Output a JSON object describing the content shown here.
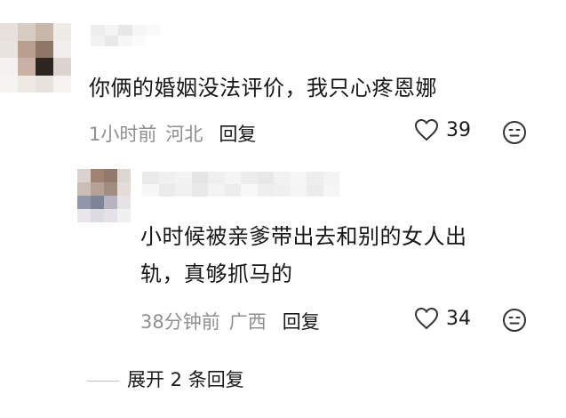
{
  "comments": [
    {
      "text": "你俩的婚姻没法评价，我只心疼恩娜",
      "time": "1小时前",
      "location": "河北",
      "reply_label": "回复",
      "likes": "39",
      "avatar_colors": [
        "#e6e1dc",
        "#d6ccc4",
        "#c8b8ac",
        "#efece8",
        "#e9e4df",
        "#b99f90",
        "#8f7666",
        "#f1eeeb",
        "#f4f1ee",
        "#c9b2a4",
        "#2d2520",
        "#dcd4ce",
        "#f6f4f2",
        "#efe9e4",
        "#e8e2dc",
        "#f5f3f1"
      ],
      "name_colors": [
        "#eeeeee",
        "#f4f4f4",
        "#e7e7e7",
        "#f6f6f6",
        "#fafafa",
        "#f2f2f2",
        "#e9e9e9",
        "#f7f7f7",
        "#fbfbfb",
        "#ffffff"
      ]
    },
    {
      "text_line1": "小时候被亲爹带出去和别的女人出",
      "text_line2": "轨，真够抓马的",
      "time": "38分钟前",
      "location": "广西",
      "reply_label": "回复",
      "likes": "34",
      "avatar_colors": [
        "#d9d2cf",
        "#a08373",
        "#93796c",
        "#ddd7d3",
        "#cbbdb5",
        "#b5a196",
        "#a28d82",
        "#e3dcd8",
        "#9197a8",
        "#7d8497",
        "#b8b3c1",
        "#e6e3e6",
        "#e8e6ea",
        "#dcdbe1",
        "#e4e2e6",
        "#f1f0f1"
      ],
      "name_colors": [
        "#eaeaea",
        "#f0f0f0",
        "#f3f3f3",
        "#e5e5e5",
        "#efefef",
        "#f5f5f5",
        "#ececec",
        "#e8e8e8",
        "#f2f2f2",
        "#f6f6f6",
        "#eeeeee",
        "#f4f4f4",
        "#f7f7f7",
        "#ebebeb",
        "#f1f1f1",
        "#e9e9e9",
        "#f3f3f3",
        "#ededed",
        "#f8f8f8",
        "#eeeeee",
        "#f0f0f0",
        "#f5f5f5",
        "#ececec",
        "#f6f6f6"
      ]
    }
  ],
  "expand_label": "展开 2 条回复"
}
